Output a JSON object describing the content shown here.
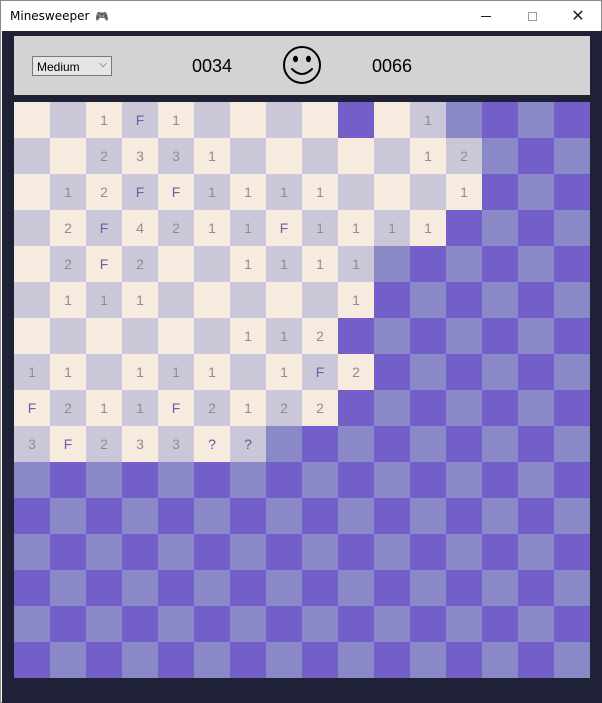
{
  "window": {
    "title": "Minesweeper",
    "icon": "game-controller-icon",
    "icon_glyph": "🎮",
    "controls": {
      "minimize": "minimize-icon",
      "maximize": "maximize-icon",
      "close_glyph": "✕"
    }
  },
  "toolbar": {
    "difficulty": "Medium",
    "difficulty_chevron": "⌵",
    "mine_counter": "0034",
    "smiley": "smiley-face-icon",
    "timer": "0066"
  },
  "colors": {
    "open_light": "#f7ebe0",
    "open_dark": "#cac7d9",
    "covered_light": "#8989c8",
    "covered_dark": "#745ec8",
    "background": "#1f2137",
    "toolbar": "#d3d3d3"
  },
  "board": {
    "rows": 16,
    "cols": 16,
    "legend": {
      "#": "covered",
      ".": "open-empty",
      "F": "flag",
      "?": "question",
      "1-8": "number"
    },
    "cells": [
      "..1F1....#.1####",
      "..2331.....12###",
      ".12FF1111...1###",
      ".2F4211F1111####",
      ".2F2..1111######",
      ".111.....1######",
      "......112#######",
      "11.111.1F2######",
      "F211F2122#######",
      "3F233??#########",
      "################",
      "################",
      "################",
      "################",
      "################",
      "################"
    ]
  }
}
